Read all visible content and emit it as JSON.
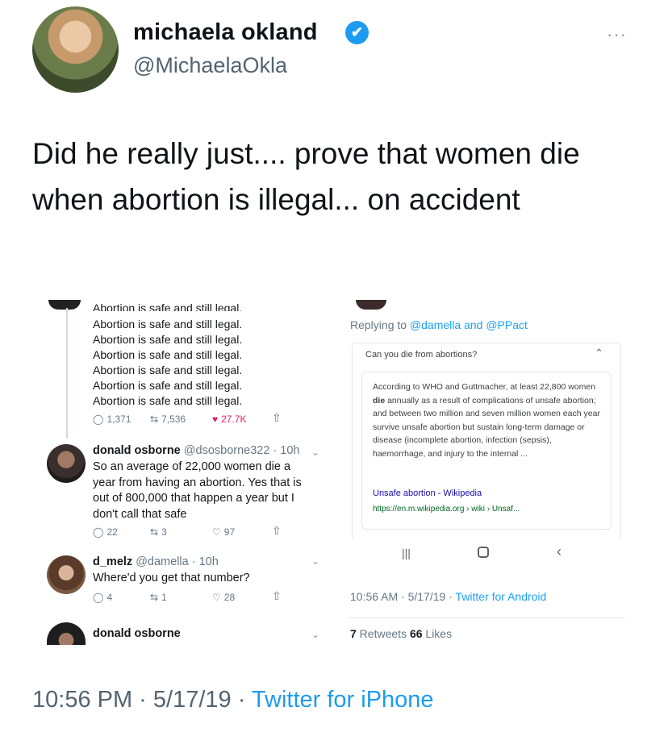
{
  "author": {
    "name": "michaela okland",
    "handle": "@MichaelaOkla",
    "verified_icon": "✔",
    "more_icon": "···"
  },
  "tweet": {
    "text": "Did he really just.... prove that women die when abortion is illegal... on accident"
  },
  "left_shot": {
    "cut_line": "Abortion is safe and still legal.",
    "repeated_lines": [
      "Abortion is safe and still legal.",
      "Abortion is safe and still legal.",
      "Abortion is safe and still legal.",
      "Abortion is safe and still legal.",
      "Abortion is safe and still legal.",
      "Abortion is safe and still legal."
    ],
    "first_actions": {
      "replies": "1,371",
      "retweets": "7,536",
      "likes": "27.7K"
    },
    "reply1": {
      "name": "donald osborne",
      "handle_time": "@dsosborne322 · 10h",
      "text": "So an average of 22,000 women die a year from having an abortion. Yes that is out of 800,000 that happen a year but I don't call that safe",
      "replies": "22",
      "retweets": "3",
      "likes": "97"
    },
    "reply2": {
      "name": "d_melz",
      "handle_time": "@damella · 10h",
      "text": "Where'd you get that number?",
      "replies": "4",
      "retweets": "1",
      "likes": "28"
    },
    "reply3": {
      "name": "donald osborne"
    }
  },
  "right_shot": {
    "replying_prefix": "Replying to ",
    "replying_targets": "@damella and @PPact",
    "question": "Can you die from abortions?",
    "answer": "According to WHO and Guttmacher, at least 22,800 women die annually as a result of complications of unsafe abortion; and between two million and seven million women each year survive unsafe abortion but sustain long-term damage or disease (incomplete abortion, infection (sepsis), haemorrhage, and injury to the internal ...",
    "answer_bold_word": "die",
    "wiki_title": "Unsafe abortion - Wikipedia",
    "wiki_url": "https://en.m.wikipedia.org › wiki › Unsaf...",
    "time": "10:56 AM · 5/17/19 · ",
    "client": "Twitter for Android",
    "retweets_count": "7",
    "retweets_label": " Retweets ",
    "likes_count": "66",
    "likes_label": " Likes"
  },
  "footer": {
    "time": "10:56 PM · 5/17/19 · ",
    "client": "Twitter for iPhone"
  },
  "colors": {
    "brand_blue": "#1d9bf0",
    "like_red": "#e0245e"
  }
}
